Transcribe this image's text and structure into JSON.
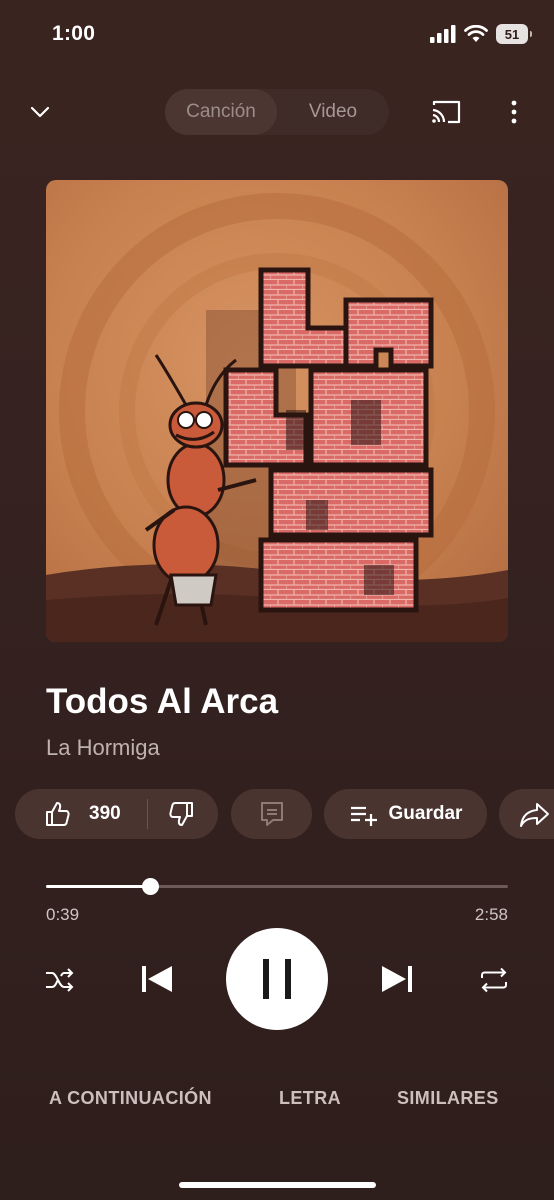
{
  "status_bar": {
    "time": "1:00",
    "battery": "51"
  },
  "top_bar": {
    "tabs": [
      {
        "label": "Canción",
        "active": true
      },
      {
        "label": "Video",
        "active": false
      }
    ]
  },
  "album_art": {
    "icon": "album-cover-la-hormiga"
  },
  "song": {
    "title": "Todos Al Arca",
    "artist": "La Hormiga"
  },
  "actions": {
    "like_count": "390",
    "save_label": "Guardar"
  },
  "player": {
    "current_time": "0:39",
    "total_time": "2:58",
    "progress": 0.225
  },
  "tabs": [
    "A CONTINUACIÓN",
    "LETRA",
    "SIMILARES"
  ],
  "colors": {
    "background": "#352220",
    "pill": "#4a3430",
    "accent": "#ffffff"
  }
}
